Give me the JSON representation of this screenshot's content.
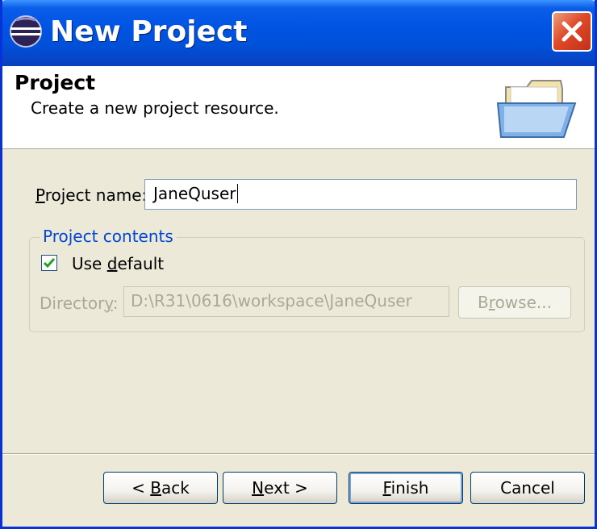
{
  "window": {
    "title": "New Project"
  },
  "header": {
    "heading": "Project",
    "description": "Create a new project resource."
  },
  "form": {
    "project_name_label_pre": "",
    "project_name_label_u": "P",
    "project_name_label_post": "roject name:",
    "project_name_value": "JaneQuser",
    "group_title": "Project contents",
    "use_default_pre": "Use ",
    "use_default_u": "d",
    "use_default_post": "efault",
    "use_default_checked": true,
    "directory_label_pre": "Director",
    "directory_label_u": "y",
    "directory_label_post": ":",
    "directory_value": "D:\\R31\\0616\\workspace\\JaneQuser",
    "browse_pre": "B",
    "browse_u": "r",
    "browse_post": "owse..."
  },
  "buttons": {
    "back_pre": "< ",
    "back_u": "B",
    "back_post": "ack",
    "next_u": "N",
    "next_post": "ext >",
    "finish_u": "F",
    "finish_post": "inish",
    "cancel": "Cancel"
  },
  "colors": {
    "titlebar": "#0054e3",
    "group_title": "#0046d5",
    "dialog_bg": "#ece9d8"
  }
}
